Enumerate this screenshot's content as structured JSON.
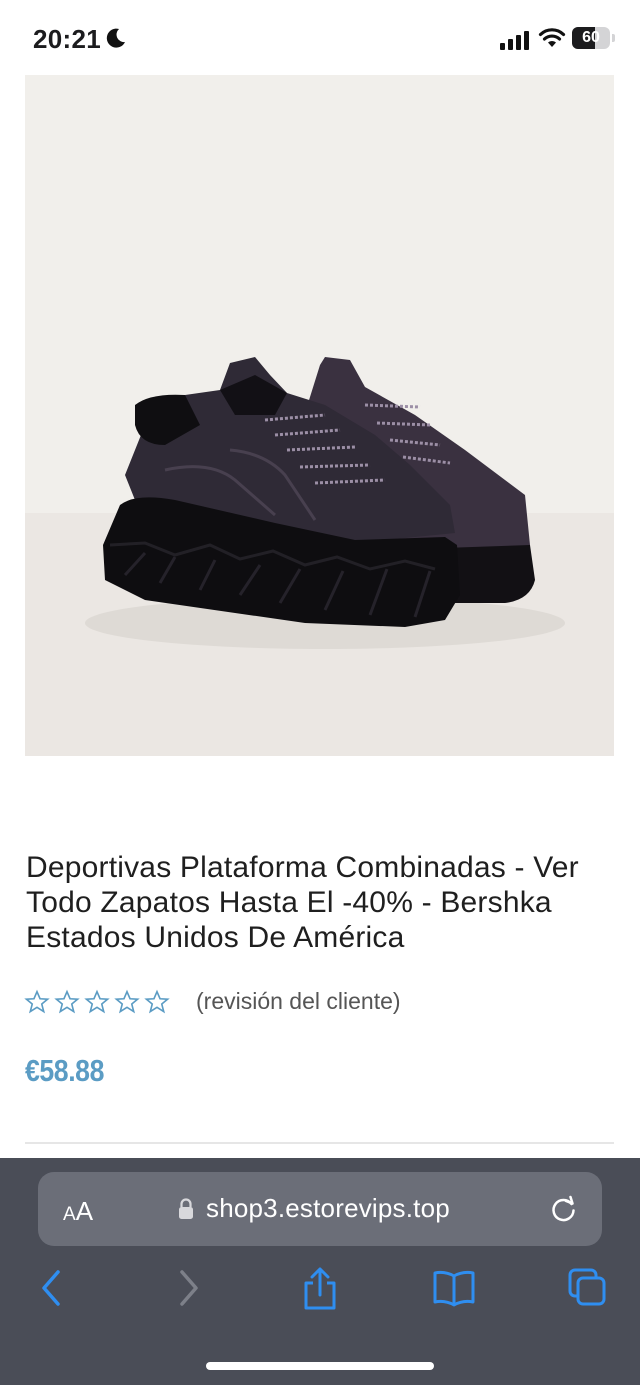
{
  "status_bar": {
    "time": "20:21",
    "battery": "60",
    "battery_level": 0.6,
    "icons": [
      "moon-icon",
      "cellular-signal-icon",
      "wifi-icon",
      "battery-icon"
    ]
  },
  "product": {
    "image": "sneaker-photo",
    "title": "Deportivas Plataforma Combinadas - Ver Todo Zapatos Hasta El -40% - Bershka Estados Unidos De América",
    "rating_stars": 0,
    "rating_max": 5,
    "review_label": "(revisión del cliente)",
    "price": "€58.88"
  },
  "browser": {
    "text_size_small": "A",
    "text_size_large": "A",
    "url": "shop3.estorevips.top",
    "toolbar_icons": [
      "back-icon",
      "forward-icon",
      "share-icon",
      "bookmarks-icon",
      "tabs-icon"
    ]
  },
  "colors": {
    "price": "#5b9cc4",
    "star_outline": "#5b9cc4",
    "browser_chrome": "#4a4d57",
    "address_bar": "#6b6e78",
    "toolbar_icon": "#2f8ef0"
  }
}
